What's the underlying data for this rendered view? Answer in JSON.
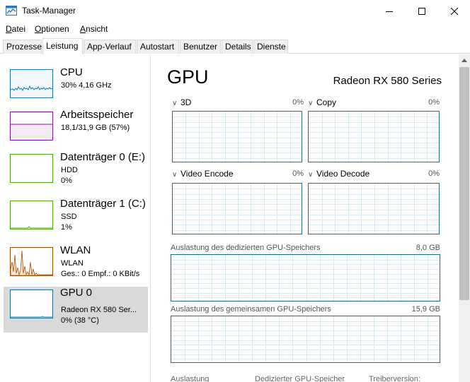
{
  "window": {
    "title": "Task-Manager"
  },
  "menu": [
    {
      "key": "D",
      "rest": "atei"
    },
    {
      "key": "O",
      "rest": "ptionen"
    },
    {
      "key": "A",
      "rest": "nsicht"
    }
  ],
  "tabs": [
    "Prozesse",
    "Leistung",
    "App-Verlauf",
    "Autostart",
    "Benutzer",
    "Details",
    "Dienste"
  ],
  "active_tab": "Leistung",
  "sidebar": {
    "items": [
      {
        "title": "CPU",
        "line1": "30%  4,16 GHz",
        "line2": "",
        "color": "#1779ba"
      },
      {
        "title": "Arbeitsspeicher",
        "line1": "18,1/31,9 GB (57%)",
        "line2": "",
        "color": "#8b12ae"
      },
      {
        "title": "Datenträger 0 (E:)",
        "line1": "HDD",
        "line2": "0%",
        "color": "#4da60c"
      },
      {
        "title": "Datenträger 1 (C:)",
        "line1": "SSD",
        "line2": "1%",
        "color": "#4da60c"
      },
      {
        "title": "WLAN",
        "line1": "WLAN",
        "line2": "Ges.: 0 Empf.: 0 KBit/s",
        "color": "#a74f01"
      },
      {
        "title": "GPU 0",
        "line1": "Radeon RX 580 Ser...",
        "line2": "0% (38 °C)",
        "color": "#1c6f90"
      }
    ]
  },
  "main": {
    "title": "GPU",
    "model": "Radeon RX 580 Series",
    "engines": [
      {
        "label": "3D",
        "pct": "0%"
      },
      {
        "label": "Copy",
        "pct": "0%"
      },
      {
        "label": "Video Encode",
        "pct": "0%"
      },
      {
        "label": "Video Decode",
        "pct": "0%"
      }
    ],
    "dedicated_label": "Auslastung des dedizierten GPU-Speichers",
    "dedicated_value": "8,0 GB",
    "shared_label": "Auslastung des gemeinsamen GPU-Speichers",
    "shared_value": "15,9 GB",
    "stats_labels": [
      "Auslastung",
      "Dedizierter GPU-Speicher",
      "Treiberversion:"
    ]
  }
}
